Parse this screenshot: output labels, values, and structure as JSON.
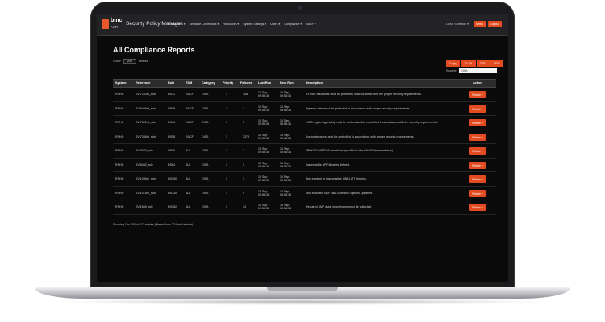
{
  "app": {
    "brand": "bmc",
    "product": "ASR",
    "title": "Security Policy Manager",
    "menu": [
      "Data Sets ▾",
      "Sensitive Commands ▾",
      "Resources ▾",
      "System Settings ▾",
      "Users ▾",
      "Compliance ▾",
      "RACF ▾"
    ],
    "selector": "LPAR Selection ▾",
    "menu_button": "Menu",
    "logout_button": "Logout"
  },
  "page": {
    "title": "All Compliance Reports",
    "show_label": "Show",
    "show_value": "200",
    "entries_label": "entries",
    "export_buttons": [
      "Copy",
      "XLSX",
      "CSV",
      "PDF"
    ],
    "search_label": "Search:",
    "search_value": "DISA",
    "footer": "Showing 1 to 200 of 213 entries (filtered from 274 total entries)"
  },
  "table": {
    "columns": [
      "System",
      "Reference",
      "Rule",
      "ESM",
      "Category",
      "Priority",
      "Failures",
      "Last Run",
      "Next Run",
      "Description",
      "Action"
    ],
    "rows": [
      {
        "system": "RSHO",
        "reference": "SV-7233r5_rule",
        "rule": "DS31",
        "esm": "RACF",
        "category": "DISA",
        "priority": "1",
        "failures": "108",
        "last_run": "15 Sep\n09:58:36",
        "next_run": "16 Sep\n09:58:36",
        "description": "CFSMS resources must be protected in accordance with the proper security requirements.",
        "action": "Select ▾"
      },
      {
        "system": "RSHO",
        "reference": "SV-6409r9_rule",
        "rule": "DS09",
        "esm": "RACF",
        "category": "DISA",
        "priority": "1",
        "failures": "1",
        "last_run": "15 Sep\n09:58:36",
        "next_run": "16 Sep\n09:58:36",
        "description": "Dynamic lists must be protected in accordance with proper security requirements.",
        "action": "Select ▾"
      },
      {
        "system": "RSHO",
        "reference": "SV-7322r5_rule",
        "rule": "DS46",
        "esm": "RACF",
        "category": "DISA",
        "priority": "1",
        "failures": "3",
        "last_run": "15 Sep\n09:58:36",
        "next_run": "16 Sep\n09:58:36",
        "description": "CICS region logonid(s) must be defined and/or controlled in accordance with the security requirements.",
        "action": "Select ▾"
      },
      {
        "system": "RSHO",
        "reference": "SV-7346r5_rule",
        "rule": "DS58",
        "esm": "RACF",
        "category": "DISA",
        "priority": "1",
        "failures": "1378",
        "last_run": "15 Sep\n09:58:36",
        "next_run": "16 Sep\n09:58:36",
        "description": "Surrogate users must be controlled in accordance with proper security requirements.",
        "action": "Select ▾"
      },
      {
        "system": "RSHO",
        "reference": "SV-3023_rule",
        "rule": "DS80",
        "esm": "ALL",
        "category": "DISA",
        "priority": "1",
        "failures": "1",
        "last_run": "15 Sep\n09:58:36",
        "next_run": "16 Sep\n09:58:36",
        "description": "UNIXUID=APF240 should be specified in the BACKSfax member(s).",
        "action": "Select ▾"
      },
      {
        "system": "RSHO",
        "reference": "SV-8442_rule",
        "rule": "DS84",
        "esm": "ALL",
        "category": "DISA",
        "priority": "1",
        "failures": "3",
        "last_run": "15 Sep\n09:58:36",
        "next_run": "16 Sep\n09:58:36",
        "description": "Inaccessible APF libraries defined.",
        "action": "Select ▾"
      },
      {
        "system": "RSHO",
        "reference": "SV-1086r1_rule",
        "rule": "DS180",
        "esm": "ALL",
        "category": "DISA",
        "priority": "1",
        "failures": "1",
        "last_run": "15 Sep\n09:58:36",
        "next_run": "16 Sep\n09:58:36",
        "description": "Non existent or inaccessible LINKLIST libraries.",
        "action": "Select ▾"
      },
      {
        "system": "RSHO",
        "reference": "SV-1016r2_rule",
        "rule": "DS130",
        "esm": "ALL",
        "category": "DISA",
        "priority": "1",
        "failures": "4",
        "last_run": "15 Sep\n09:58:36",
        "next_run": "16 Sep\n09:58:36",
        "description": "Non-standard SMF data collection options specified.",
        "action": "Select ▾"
      },
      {
        "system": "RSHO",
        "reference": "SV-1665_rule",
        "rule": "DS182",
        "esm": "ALL",
        "category": "DISA",
        "priority": "1",
        "failures": "14",
        "last_run": "15 Sep\n09:58:36",
        "next_run": "16 Sep\n09:58:36",
        "description": "Required SMF data record types must be collected.",
        "action": "Select ▾"
      }
    ]
  },
  "colors": {
    "accent": "#e24b1f",
    "background": "#0a0a0a",
    "navbar": "#232325"
  }
}
